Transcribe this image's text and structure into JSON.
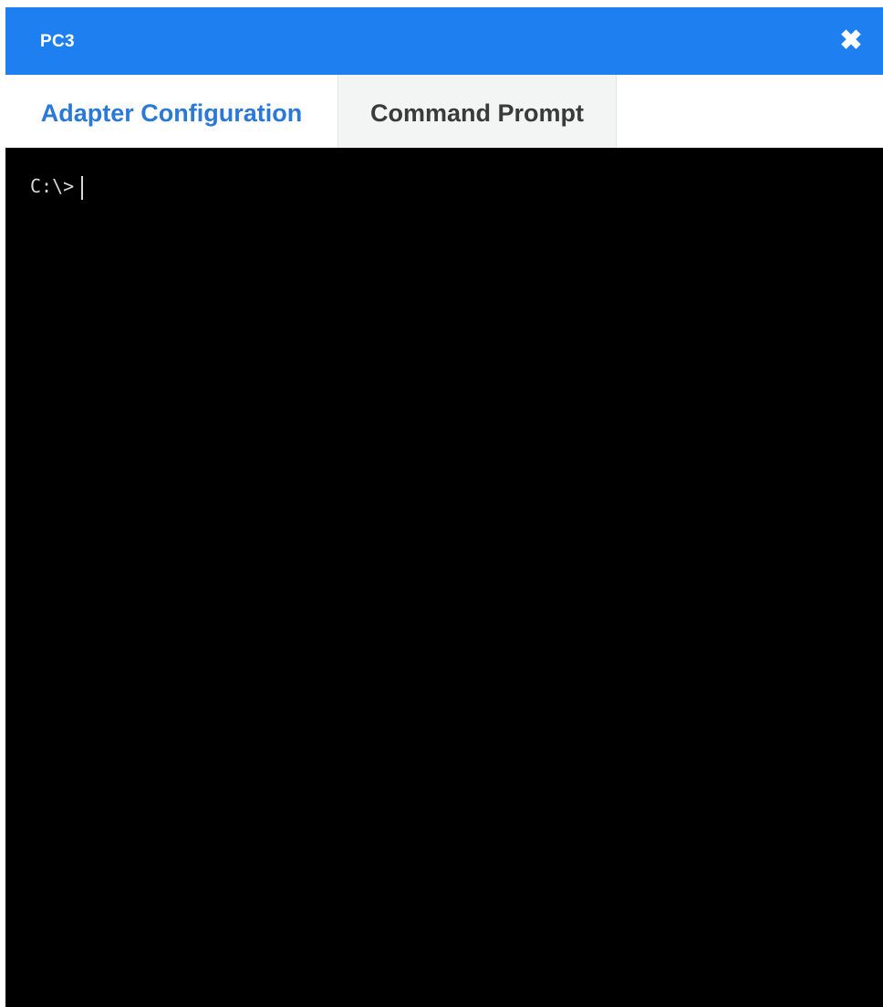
{
  "window": {
    "title": "PC3",
    "close_glyph": "✖",
    "titlebar_color": "#1e7ff0"
  },
  "tabs": [
    {
      "label": "Adapter Configuration",
      "color": "#2a79d6"
    },
    {
      "label": "Command Prompt",
      "color": "#3a3a3a"
    }
  ],
  "terminal": {
    "prompt": "C:\\>",
    "background": "#000000",
    "text_color": "#d9d9d9"
  },
  "icons": {
    "close": "close-icon"
  }
}
